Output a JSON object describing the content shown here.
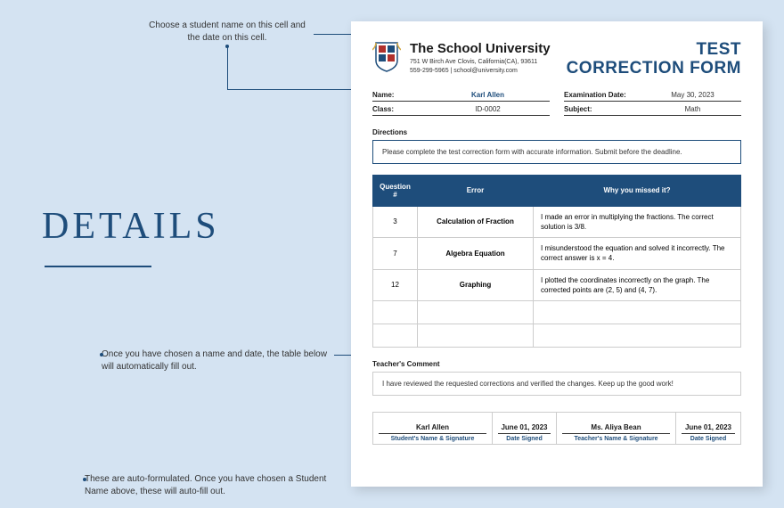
{
  "details_heading": "DETAILS",
  "callouts": {
    "top": "Choose a student name on this cell and the date on this cell.",
    "mid": "Once you have chosen a name and date, the table below will automatically fill out.",
    "bottom": "These are auto-formulated. Once you have chosen a Student Name above, these will auto-fill out."
  },
  "school": {
    "name": "The School University",
    "addr1": "751 W Birch Ave Clovis, California(CA), 93611",
    "addr2": "559-299-5965 | school@university.com"
  },
  "form_title_1": "TEST",
  "form_title_2": "CORRECTION FORM",
  "meta": {
    "name_label": "Name:",
    "name_value": "Karl Allen",
    "exam_label": "Examination Date:",
    "exam_value": "May 30, 2023",
    "class_label": "Class:",
    "class_value": "ID-0002",
    "subject_label": "Subject:",
    "subject_value": "Math"
  },
  "directions_label": "Directions",
  "directions_text": "Please complete the test correction form with accurate information. Submit before the deadline.",
  "cols": {
    "q": "Question #",
    "e": "Error",
    "w": "Why you missed it?"
  },
  "rows": [
    {
      "q": "3",
      "e": "Calculation of Fraction",
      "w": "I made an error in multiplying the fractions. The correct solution is 3/8."
    },
    {
      "q": "7",
      "e": "Algebra Equation",
      "w": "I misunderstood the equation and solved it incorrectly. The correct answer is x = 4."
    },
    {
      "q": "12",
      "e": "Graphing",
      "w": "I plotted the coordinates incorrectly on the graph. The corrected points are (2, 5) and (4, 7)."
    }
  ],
  "comment_label": "Teacher's Comment",
  "comment_text": "I have reviewed the requested corrections and verified the changes. Keep up the good work!",
  "sig": {
    "student_name": "Karl Allen",
    "student_label": "Student's Name & Signature",
    "date1": "June 01, 2023",
    "date1_label": "Date Signed",
    "teacher_name": "Ms. Aliya Bean",
    "teacher_label": "Teacher's Name & Signature",
    "date2": "June 01, 2023",
    "date2_label": "Date Signed"
  }
}
